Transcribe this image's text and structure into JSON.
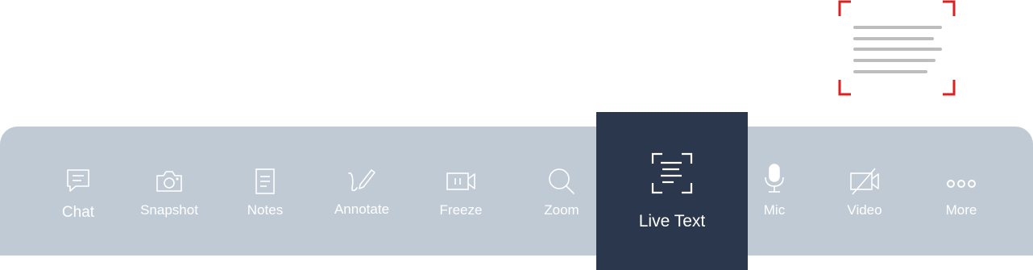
{
  "toolbar": {
    "items": [
      {
        "label": "Chat",
        "icon": "chat-icon"
      },
      {
        "label": "Snapshot",
        "icon": "camera-icon"
      },
      {
        "label": "Notes",
        "icon": "notes-icon"
      },
      {
        "label": "Annotate",
        "icon": "pen-icon"
      },
      {
        "label": "Freeze",
        "icon": "freeze-video-icon"
      },
      {
        "label": "Zoom",
        "icon": "magnifier-icon"
      },
      {
        "label": "Live Text",
        "icon": "scan-text-icon",
        "active": true
      },
      {
        "label": "Mic",
        "icon": "microphone-icon"
      },
      {
        "label": "Video",
        "icon": "video-off-icon"
      },
      {
        "label": "More",
        "icon": "more-dots-icon"
      }
    ]
  },
  "colors": {
    "toolbar_bg": "#c0cad4",
    "active_bg": "#2b374c",
    "icon_label": "#ffffff",
    "scan_frame": "#e02020",
    "scan_lines": "#bdbdbd"
  }
}
